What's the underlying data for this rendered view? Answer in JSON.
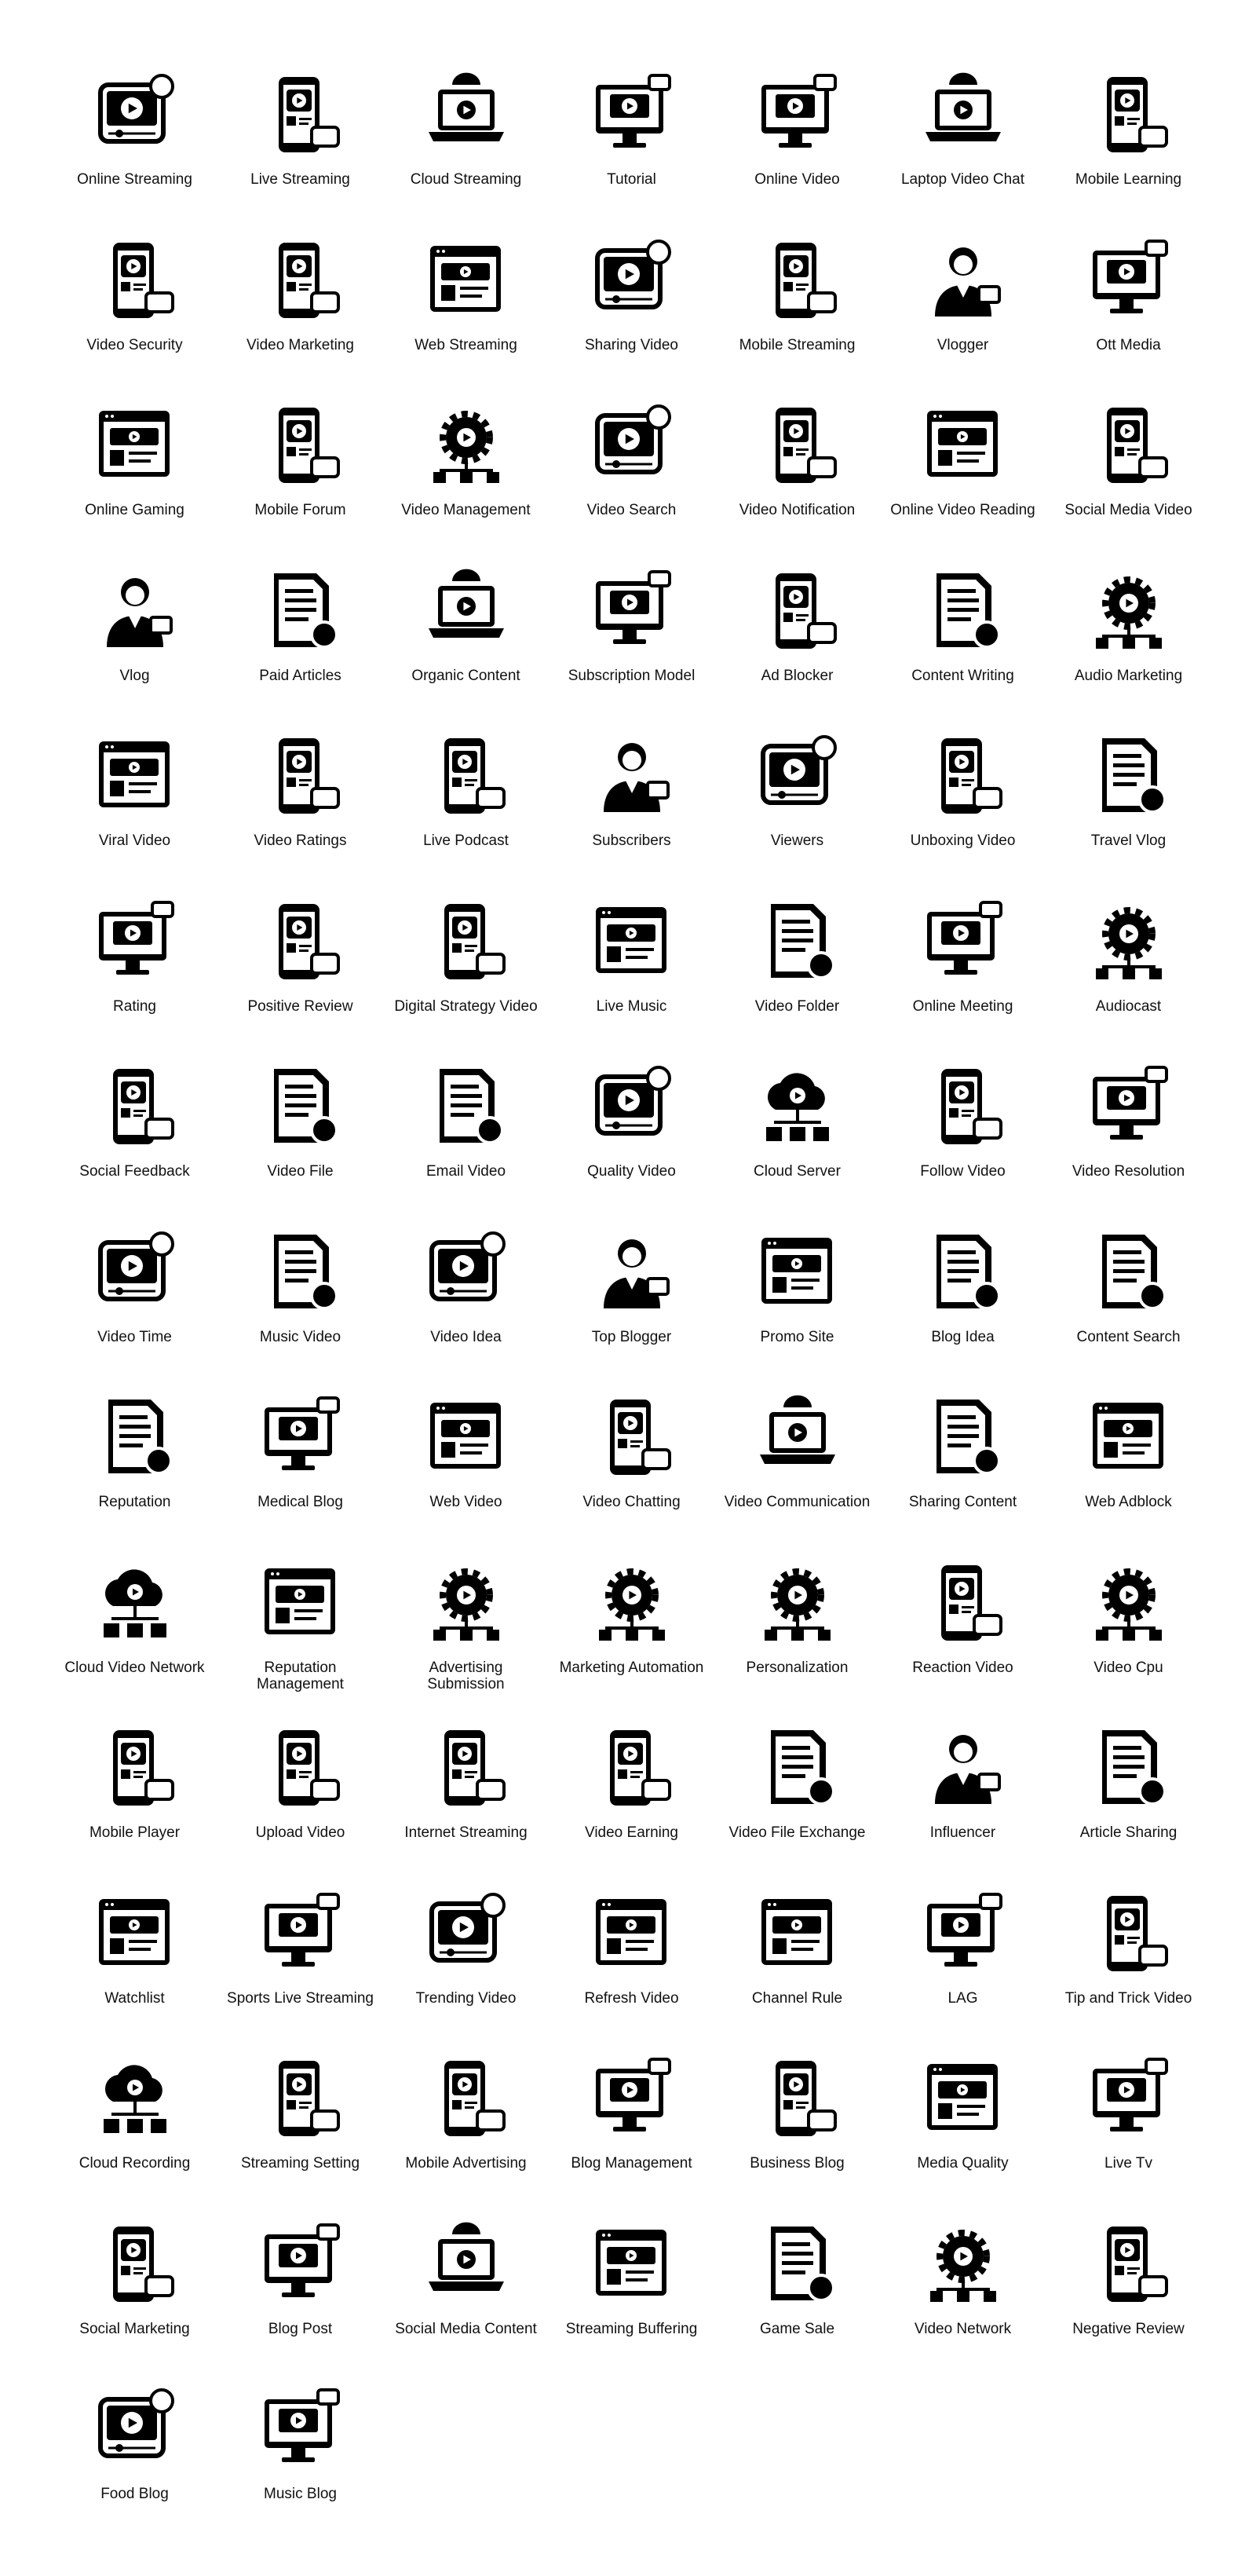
{
  "colors": {
    "icon": "#000000",
    "text": "#111111",
    "background": "#ffffff"
  },
  "items": [
    {
      "label": "Online Streaming",
      "icon": "online-streaming-icon",
      "shape": "monitor"
    },
    {
      "label": "Live Streaming",
      "icon": "live-streaming-icon",
      "shape": "phone"
    },
    {
      "label": "Cloud Streaming",
      "icon": "cloud-streaming-icon",
      "shape": "laptop"
    },
    {
      "label": "Tutorial",
      "icon": "tutorial-icon",
      "shape": "desktop"
    },
    {
      "label": "Online Video",
      "icon": "online-video-icon",
      "shape": "desktop"
    },
    {
      "label": "Laptop Video Chat",
      "icon": "laptop-video-chat-icon",
      "shape": "laptop"
    },
    {
      "label": "Mobile Learning",
      "icon": "mobile-learning-icon",
      "shape": "phone"
    },
    {
      "label": "Video Security",
      "icon": "video-security-icon",
      "shape": "phone"
    },
    {
      "label": "Video Marketing",
      "icon": "video-marketing-icon",
      "shape": "phone"
    },
    {
      "label": "Web Streaming",
      "icon": "web-streaming-icon",
      "shape": "browser"
    },
    {
      "label": "Sharing Video",
      "icon": "sharing-video-icon",
      "shape": "monitor"
    },
    {
      "label": "Mobile Streaming",
      "icon": "mobile-streaming-icon",
      "shape": "phone"
    },
    {
      "label": "Vlogger",
      "icon": "vlogger-icon",
      "shape": "person"
    },
    {
      "label": "Ott Media",
      "icon": "ott-media-icon",
      "shape": "desktop"
    },
    {
      "label": "Online Gaming",
      "icon": "online-gaming-icon",
      "shape": "browser"
    },
    {
      "label": "Mobile Forum",
      "icon": "mobile-forum-icon",
      "shape": "phone"
    },
    {
      "label": "Video Management",
      "icon": "video-management-icon",
      "shape": "gear"
    },
    {
      "label": "Video Search",
      "icon": "video-search-icon",
      "shape": "monitor"
    },
    {
      "label": "Video Notification",
      "icon": "video-notification-icon",
      "shape": "phone"
    },
    {
      "label": "Online Video Reading",
      "icon": "online-video-reading-icon",
      "shape": "browser"
    },
    {
      "label": "Social Media Video",
      "icon": "social-media-video-icon",
      "shape": "phone"
    },
    {
      "label": "Vlog",
      "icon": "vlog-icon",
      "shape": "person"
    },
    {
      "label": "Paid Articles",
      "icon": "paid-articles-icon",
      "shape": "doc"
    },
    {
      "label": "Organic Content",
      "icon": "organic-content-icon",
      "shape": "laptop"
    },
    {
      "label": "Subscription Model",
      "icon": "subscription-model-icon",
      "shape": "desktop"
    },
    {
      "label": "Ad Blocker",
      "icon": "ad-blocker-icon",
      "shape": "phone"
    },
    {
      "label": "Content Writing",
      "icon": "content-writing-icon",
      "shape": "doc"
    },
    {
      "label": "Audio Marketing",
      "icon": "audio-marketing-icon",
      "shape": "gear"
    },
    {
      "label": "Viral Video",
      "icon": "viral-video-icon",
      "shape": "browser"
    },
    {
      "label": "Video Ratings",
      "icon": "video-ratings-icon",
      "shape": "phone"
    },
    {
      "label": "Live Podcast",
      "icon": "live-podcast-icon",
      "shape": "phone"
    },
    {
      "label": "Subscribers",
      "icon": "subscribers-icon",
      "shape": "person"
    },
    {
      "label": "Viewers",
      "icon": "viewers-icon",
      "shape": "monitor"
    },
    {
      "label": "Unboxing Video",
      "icon": "unboxing-video-icon",
      "shape": "phone"
    },
    {
      "label": "Travel Vlog",
      "icon": "travel-vlog-icon",
      "shape": "doc"
    },
    {
      "label": "Rating",
      "icon": "rating-icon",
      "shape": "desktop"
    },
    {
      "label": "Positive Review",
      "icon": "positive-review-icon",
      "shape": "phone"
    },
    {
      "label": "Digital Strategy Video",
      "icon": "digital-strategy-video-icon",
      "shape": "phone"
    },
    {
      "label": "Live Music",
      "icon": "live-music-icon",
      "shape": "browser"
    },
    {
      "label": "Video Folder",
      "icon": "video-folder-icon",
      "shape": "doc"
    },
    {
      "label": "Online Meeting",
      "icon": "online-meeting-icon",
      "shape": "desktop"
    },
    {
      "label": "Audiocast",
      "icon": "audiocast-icon",
      "shape": "gear"
    },
    {
      "label": "Social Feedback",
      "icon": "social-feedback-icon",
      "shape": "phone"
    },
    {
      "label": "Video File",
      "icon": "video-file-icon",
      "shape": "doc"
    },
    {
      "label": "Email Video",
      "icon": "email-video-icon",
      "shape": "doc"
    },
    {
      "label": "Quality Video",
      "icon": "quality-video-icon",
      "shape": "monitor"
    },
    {
      "label": "Cloud Server",
      "icon": "cloud-server-icon",
      "shape": "cloud"
    },
    {
      "label": "Follow Video",
      "icon": "follow-video-icon",
      "shape": "phone"
    },
    {
      "label": "Video Resolution",
      "icon": "video-resolution-icon",
      "shape": "desktop"
    },
    {
      "label": "Video Time",
      "icon": "video-time-icon",
      "shape": "monitor"
    },
    {
      "label": "Music Video",
      "icon": "music-video-icon",
      "shape": "doc"
    },
    {
      "label": "Video Idea",
      "icon": "video-idea-icon",
      "shape": "monitor"
    },
    {
      "label": "Top Blogger",
      "icon": "top-blogger-icon",
      "shape": "person"
    },
    {
      "label": "Promo Site",
      "icon": "promo-site-icon",
      "shape": "browser"
    },
    {
      "label": "Blog Idea",
      "icon": "blog-idea-icon",
      "shape": "doc"
    },
    {
      "label": "Content Search",
      "icon": "content-search-icon",
      "shape": "doc"
    },
    {
      "label": "Reputation",
      "icon": "reputation-icon",
      "shape": "doc"
    },
    {
      "label": "Medical Blog",
      "icon": "medical-blog-icon",
      "shape": "desktop"
    },
    {
      "label": "Web Video",
      "icon": "web-video-icon",
      "shape": "browser"
    },
    {
      "label": "Video Chatting",
      "icon": "video-chatting-icon",
      "shape": "phone"
    },
    {
      "label": "Video Communication",
      "icon": "video-communication-icon",
      "shape": "laptop"
    },
    {
      "label": "Sharing Content",
      "icon": "sharing-content-icon",
      "shape": "doc"
    },
    {
      "label": "Web Adblock",
      "icon": "web-adblock-icon",
      "shape": "browser"
    },
    {
      "label": "Cloud Video Network",
      "icon": "cloud-video-network-icon",
      "shape": "cloud"
    },
    {
      "label": "Reputation\nManagement",
      "icon": "reputation-management-icon",
      "shape": "browser"
    },
    {
      "label": "Advertising\nSubmission",
      "icon": "advertising-submission-icon",
      "shape": "gear"
    },
    {
      "label": "Marketing Automation",
      "icon": "marketing-automation-icon",
      "shape": "gear"
    },
    {
      "label": "Personalization",
      "icon": "personalization-icon",
      "shape": "gear"
    },
    {
      "label": "Reaction Video",
      "icon": "reaction-video-icon",
      "shape": "phone"
    },
    {
      "label": "Video Cpu",
      "icon": "video-cpu-icon",
      "shape": "gear"
    },
    {
      "label": "Mobile Player",
      "icon": "mobile-player-icon",
      "shape": "phone"
    },
    {
      "label": "Upload Video",
      "icon": "upload-video-icon",
      "shape": "phone"
    },
    {
      "label": "Internet Streaming",
      "icon": "internet-streaming-icon",
      "shape": "phone"
    },
    {
      "label": "Video Earning",
      "icon": "video-earning-icon",
      "shape": "phone"
    },
    {
      "label": "Video File Exchange",
      "icon": "video-file-exchange-icon",
      "shape": "doc"
    },
    {
      "label": "Influencer",
      "icon": "influencer-icon",
      "shape": "person"
    },
    {
      "label": "Article Sharing",
      "icon": "article-sharing-icon",
      "shape": "doc"
    },
    {
      "label": "Watchlist",
      "icon": "watchlist-icon",
      "shape": "browser"
    },
    {
      "label": "Sports Live Streaming",
      "icon": "sports-live-streaming-icon",
      "shape": "desktop"
    },
    {
      "label": "Trending Video",
      "icon": "trending-video-icon",
      "shape": "monitor"
    },
    {
      "label": "Refresh Video",
      "icon": "refresh-video-icon",
      "shape": "browser"
    },
    {
      "label": "Channel Rule",
      "icon": "channel-rule-icon",
      "shape": "browser"
    },
    {
      "label": "LAG",
      "icon": "lag-icon",
      "shape": "desktop"
    },
    {
      "label": "Tip and Trick Video",
      "icon": "tip-and-trick-video-icon",
      "shape": "phone"
    },
    {
      "label": "Cloud Recording",
      "icon": "cloud-recording-icon",
      "shape": "cloud"
    },
    {
      "label": "Streaming Setting",
      "icon": "streaming-setting-icon",
      "shape": "phone"
    },
    {
      "label": "Mobile Advertising",
      "icon": "mobile-advertising-icon",
      "shape": "phone"
    },
    {
      "label": "Blog Management",
      "icon": "blog-management-icon",
      "shape": "desktop"
    },
    {
      "label": "Business Blog",
      "icon": "business-blog-icon",
      "shape": "phone"
    },
    {
      "label": "Media Quality",
      "icon": "media-quality-icon",
      "shape": "browser"
    },
    {
      "label": "Live Tv",
      "icon": "live-tv-icon",
      "shape": "desktop"
    },
    {
      "label": "Social Marketing",
      "icon": "social-marketing-icon",
      "shape": "phone"
    },
    {
      "label": "Blog Post",
      "icon": "blog-post-icon",
      "shape": "desktop"
    },
    {
      "label": "Social Media Content",
      "icon": "social-media-content-icon",
      "shape": "laptop"
    },
    {
      "label": "Streaming Buffering",
      "icon": "streaming-buffering-icon",
      "shape": "browser"
    },
    {
      "label": "Game Sale",
      "icon": "game-sale-icon",
      "shape": "doc"
    },
    {
      "label": "Video Network",
      "icon": "video-network-icon",
      "shape": "gear"
    },
    {
      "label": "Negative Review",
      "icon": "negative-review-icon",
      "shape": "phone"
    },
    {
      "label": "Food Blog",
      "icon": "food-blog-icon",
      "shape": "monitor"
    },
    {
      "label": "Music Blog",
      "icon": "music-blog-icon",
      "shape": "desktop"
    }
  ]
}
